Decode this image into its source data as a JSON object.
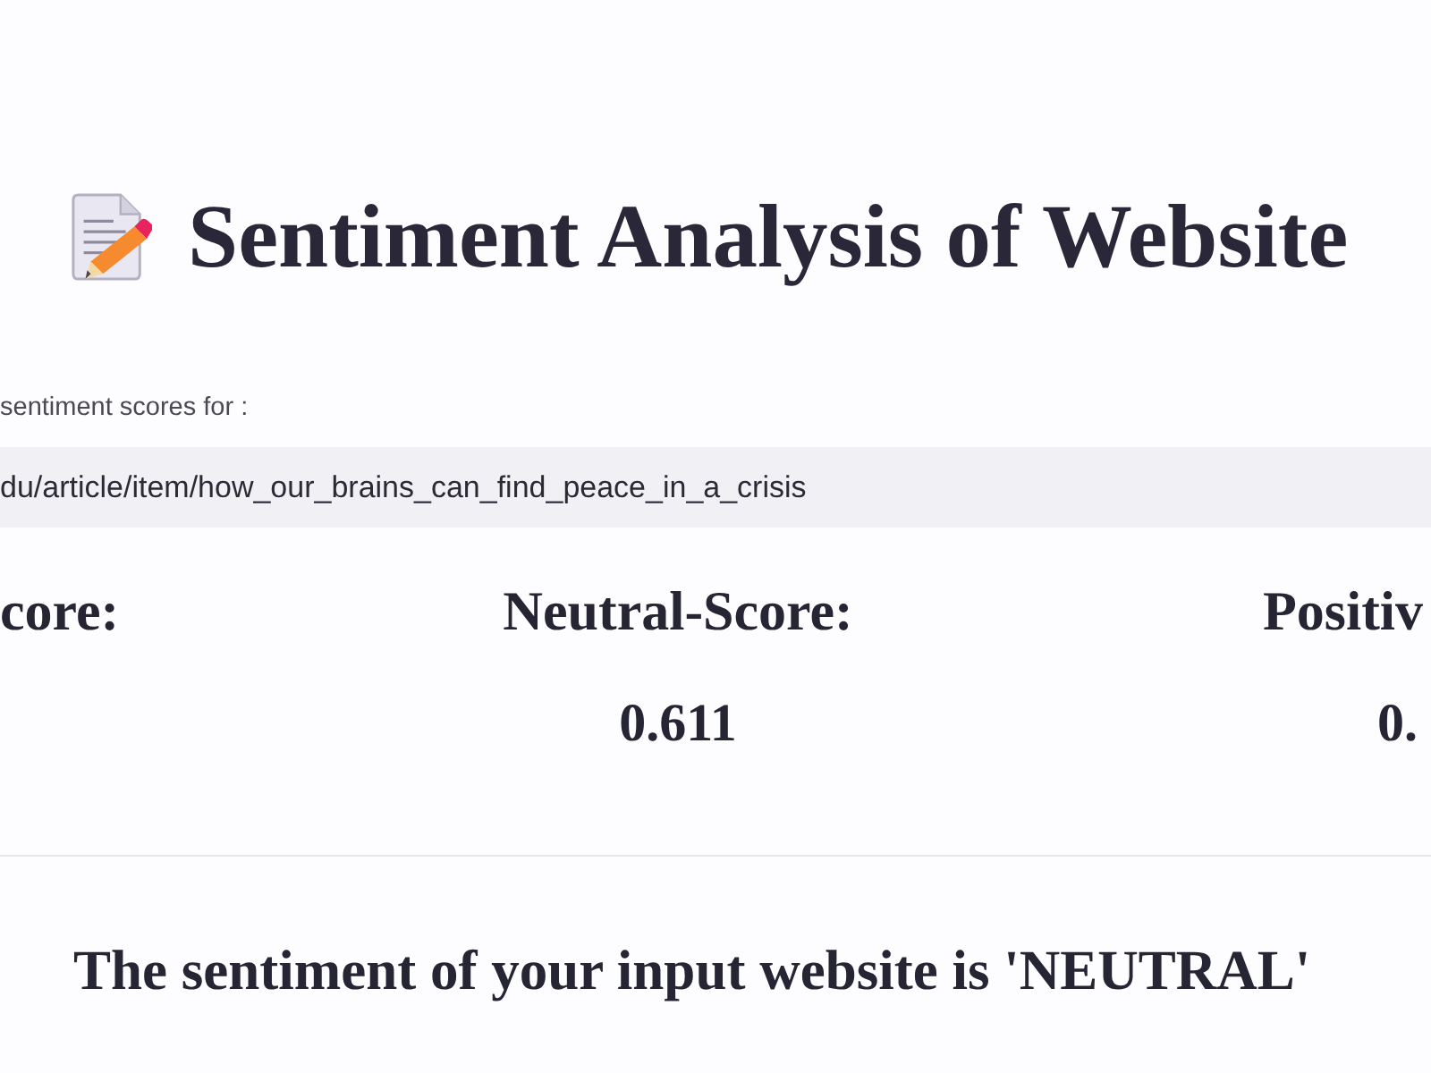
{
  "title": {
    "text": "Sentiment Analysis of Website"
  },
  "url_label": "sentiment scores for :",
  "url_field": {
    "value": "du/article/item/how_our_brains_can_find_peace_in_a_crisis"
  },
  "scores": [
    {
      "heading": "core:"
    },
    {
      "heading": "Neutral-Score:",
      "value": "0.611"
    },
    {
      "heading": "Positiv",
      "value": "0."
    }
  ],
  "result": "The sentiment of your input website is 'NEUTRAL'"
}
